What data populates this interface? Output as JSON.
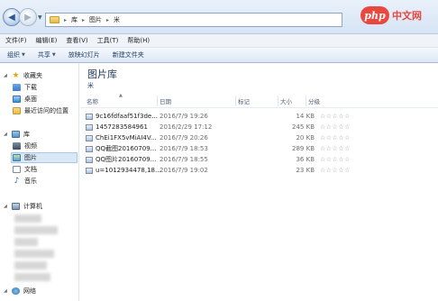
{
  "address_bar": {
    "back_icon": "back-arrow-icon",
    "forward_icon": "forward-arrow-icon",
    "breadcrumb": [
      "库",
      "图片",
      "米"
    ]
  },
  "brand": {
    "logo": "php",
    "text": "中文网"
  },
  "menu": [
    "文件(F)",
    "编辑(E)",
    "查看(V)",
    "工具(T)",
    "帮助(H)"
  ],
  "toolbar": [
    {
      "label": "组织",
      "dropdown": true
    },
    {
      "label": "共享",
      "dropdown": true
    },
    {
      "label": "放映幻灯片",
      "dropdown": false
    },
    {
      "label": "新建文件夹",
      "dropdown": false
    }
  ],
  "sidebar": {
    "favorites": {
      "label": "收藏夹",
      "items": [
        "下载",
        "桌面",
        "最近访问的位置"
      ]
    },
    "libraries": {
      "label": "库",
      "items": [
        "视频",
        "图片",
        "文档",
        "音乐"
      ],
      "selected": "图片"
    },
    "computer": {
      "label": "计算机"
    },
    "network": {
      "label": "网络"
    }
  },
  "main": {
    "title": "图片库",
    "subtitle": "米",
    "columns": [
      "名称",
      "日期",
      "标记",
      "大小",
      "分级"
    ],
    "rows": [
      {
        "name": "9c16fdfaaf51f3de...",
        "date": "2016/7/9 19:26",
        "size": "14 KB",
        "rating": "☆☆☆☆☆"
      },
      {
        "name": "1457283584961",
        "date": "2016/2/29 17:12",
        "size": "245 KB",
        "rating": "☆☆☆☆☆"
      },
      {
        "name": "ChEi1FX5vMiAI4V...",
        "date": "2016/7/9 20:26",
        "size": "20 KB",
        "rating": "☆☆☆☆☆"
      },
      {
        "name": "QQ截图20160709...",
        "date": "2016/7/9 18:53",
        "size": "289 KB",
        "rating": "☆☆☆☆☆"
      },
      {
        "name": "QQ图片20160709...",
        "date": "2016/7/9 18:55",
        "size": "36 KB",
        "rating": "☆☆☆☆☆"
      },
      {
        "name": "u=1012934478,18...",
        "date": "2016/7/9 19:02",
        "size": "23 KB",
        "rating": "☆☆☆☆☆"
      }
    ]
  }
}
